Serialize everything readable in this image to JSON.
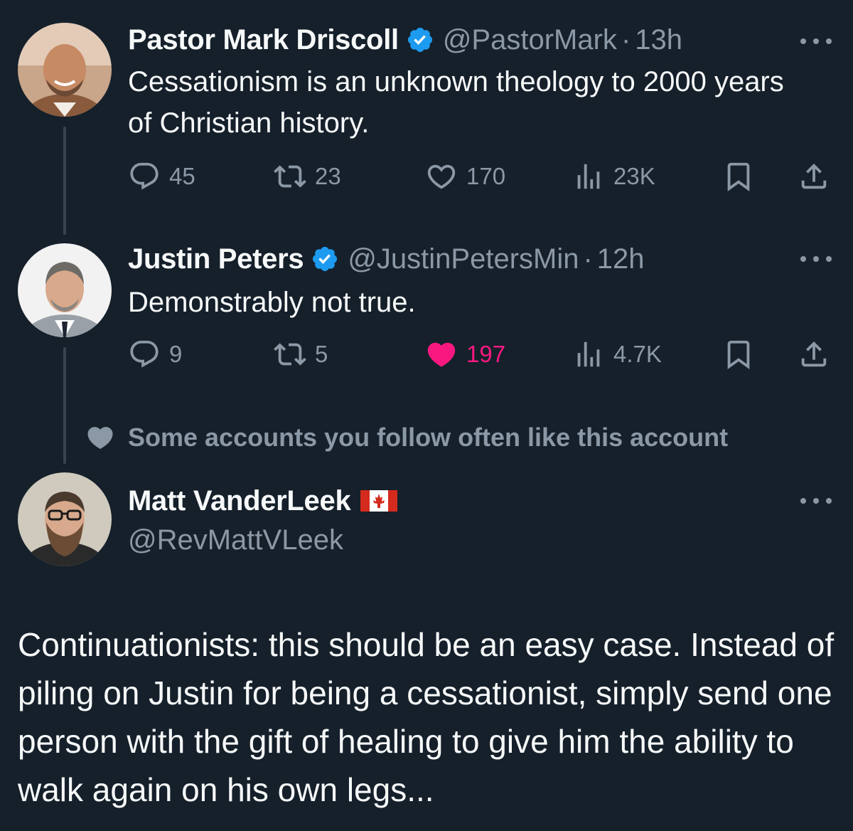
{
  "tweets": [
    {
      "name": "Pastor Mark Driscoll",
      "verified": true,
      "handle": "@PastorMark",
      "separator": "·",
      "time": "13h",
      "text": "Cessationism is an unknown theology to 2000 years of Christian history.",
      "stats": {
        "replies": "45",
        "retweets": "23",
        "likes": "170",
        "views": "23K"
      },
      "liked": false
    },
    {
      "name": "Justin Peters",
      "verified": true,
      "handle": "@JustinPetersMin",
      "separator": "·",
      "time": "12h",
      "text": "Demonstrably not true.",
      "stats": {
        "replies": "9",
        "retweets": "5",
        "likes": "197",
        "views": "4.7K"
      },
      "liked": true
    }
  ],
  "social_context": "Some accounts you follow often like this account",
  "main_tweet": {
    "name": "Matt VanderLeek",
    "handle": "@RevMattVLeek",
    "text": "Continuationists: this should be an easy case. Instead of piling on Justin for being a cessationist, simply send one person with the gift of healing to give him the ability to walk again on his own legs..."
  },
  "icons": {
    "reply": "reply-icon",
    "retweet": "retweet-icon",
    "like": "heart-icon",
    "views": "views-icon",
    "bookmark": "bookmark-icon",
    "share": "share-icon",
    "verified": "verified-badge-icon",
    "more": "more-icon",
    "flag": "canada-flag-icon"
  },
  "colors": {
    "background": "#15202b",
    "text": "#f7f9f9",
    "secondary": "#8b98a5",
    "verified": "#1d9bf0",
    "like": "#f91880"
  }
}
